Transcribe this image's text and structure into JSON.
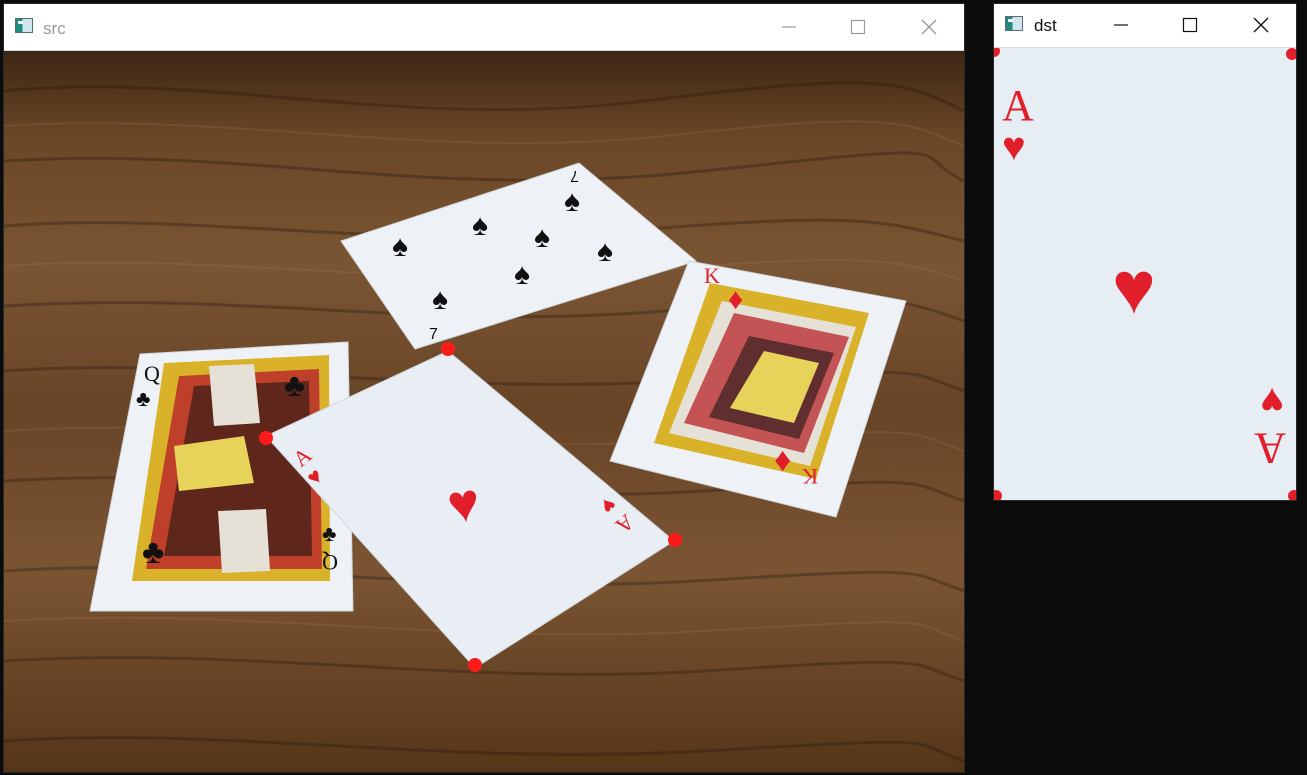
{
  "windows": {
    "src": {
      "title": "src",
      "title_color": "#9a9a9a",
      "image": {
        "background_color": "#5a3a1f",
        "cards": [
          {
            "id": "seven-of-spades",
            "rank": "7",
            "suit": "♠",
            "color": "#111111"
          },
          {
            "id": "king-of-diamonds",
            "rank": "K",
            "suit": "♦",
            "color": "#e11f2b"
          },
          {
            "id": "queen-of-clubs",
            "rank": "Q",
            "suit": "♣",
            "color": "#111111"
          },
          {
            "id": "ace-of-hearts",
            "rank": "A",
            "suit": "♥",
            "color": "#e11f2b"
          }
        ],
        "marker_color": "#ff0000"
      }
    },
    "dst": {
      "title": "dst",
      "title_color": "#111111",
      "image": {
        "card_color": "#e7eef3",
        "rank": "A",
        "suit": "♥",
        "suit_color": "#e11f2b"
      }
    }
  },
  "controls": {
    "minimize_icon": "minimize-icon",
    "maximize_icon": "maximize-icon",
    "close_icon": "close-icon"
  }
}
